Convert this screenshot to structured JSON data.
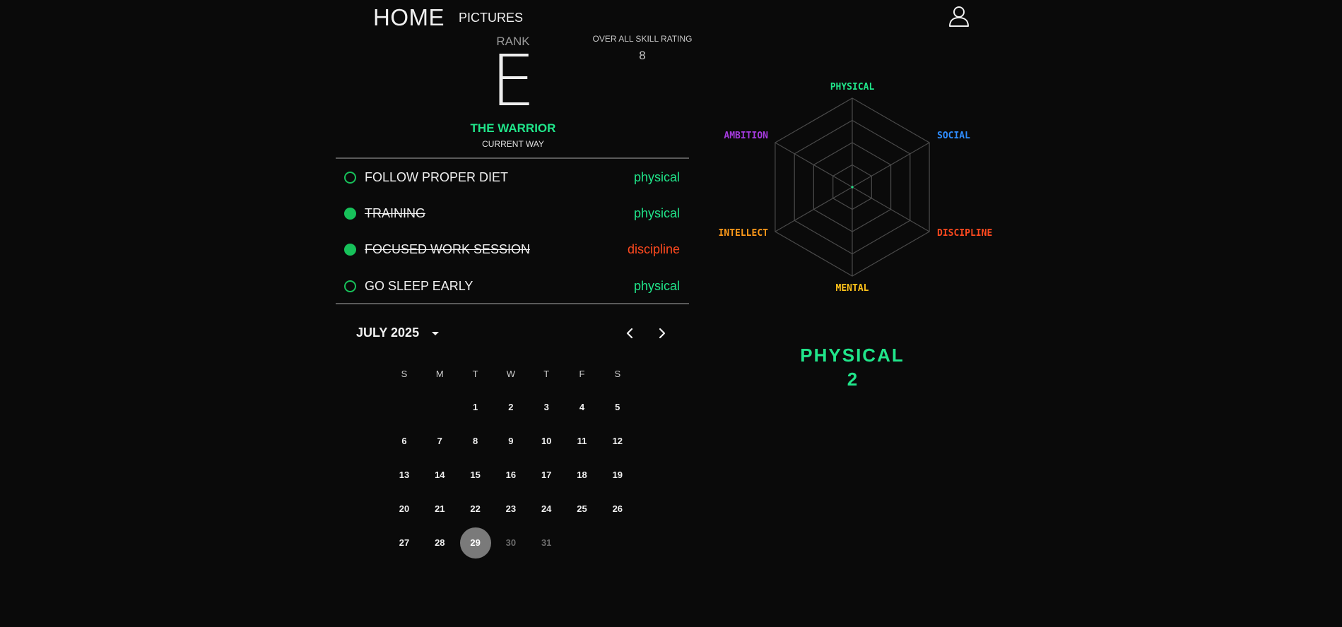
{
  "nav": {
    "home": "HOME",
    "pictures": "PICTURES"
  },
  "rank": {
    "label": "RANK",
    "letter": "E"
  },
  "way": {
    "name": "THE WARRIOR",
    "subtitle": "CURRENT WAY"
  },
  "overall": {
    "label": "OVER ALL SKILL RATING",
    "value": "8"
  },
  "tasks": [
    {
      "title": "FOLLOW PROPER DIET",
      "category": "physical",
      "done": false,
      "color": "#20e58a"
    },
    {
      "title": "TRAINING",
      "category": "physical",
      "done": true,
      "color": "#20e58a"
    },
    {
      "title": "FOCUSED WORK SESSION",
      "category": "discipline",
      "done": true,
      "color": "#ff4a1f"
    },
    {
      "title": "GO SLEEP EARLY",
      "category": "physical",
      "done": false,
      "color": "#20e58a"
    }
  ],
  "calendar": {
    "month_label": "JULY 2025",
    "weekdays": [
      "S",
      "M",
      "T",
      "W",
      "T",
      "F",
      "S"
    ],
    "first_weekday_index": 2,
    "days_in_month": 31,
    "selected_day": 29,
    "muted_days": [
      30,
      31
    ]
  },
  "radar": {
    "labels": {
      "physical": "PHYSICAL",
      "social": "SOCIAL",
      "discipline": "DISCIPLINE",
      "mental": "MENTAL",
      "intellect": "INTELLECT",
      "ambition": "AMBITION"
    },
    "colors": {
      "physical": "#20e58a",
      "social": "#2f8dff",
      "discipline": "#ff4a1f",
      "mental": "#ffc21a",
      "intellect": "#ff9a1a",
      "ambition": "#a63be0"
    }
  },
  "selected_stat": {
    "name": "PHYSICAL",
    "value": "2"
  }
}
